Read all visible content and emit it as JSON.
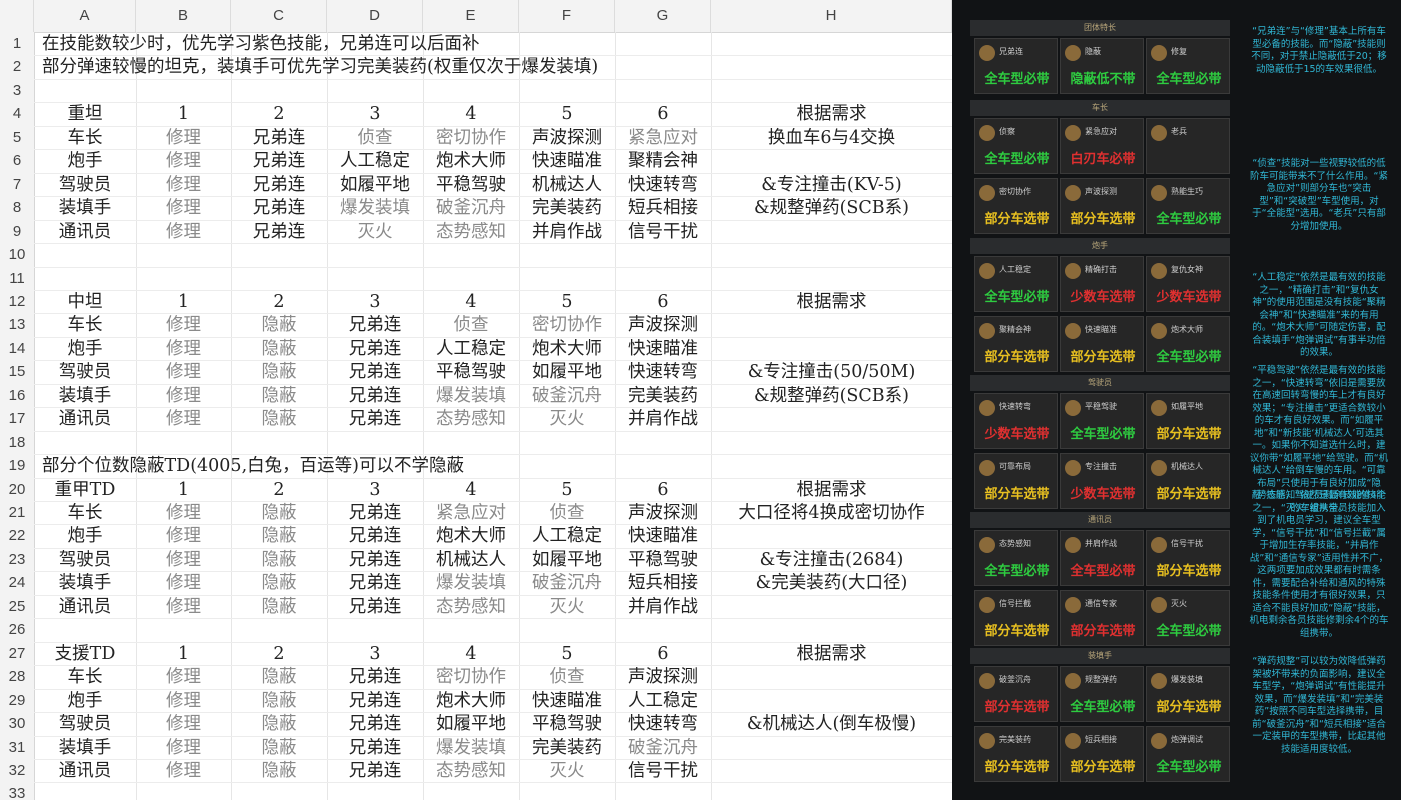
{
  "columns": [
    "A",
    "B",
    "C",
    "D",
    "E",
    "F",
    "G",
    "H"
  ],
  "rows": [
    "1",
    "2",
    "3",
    "4",
    "5",
    "6",
    "7",
    "8",
    "9",
    "10",
    "11",
    "12",
    "13",
    "14",
    "15",
    "16",
    "17",
    "18",
    "19",
    "20",
    "21",
    "22",
    "23",
    "24",
    "25",
    "26",
    "27",
    "28",
    "29",
    "30",
    "31",
    "32",
    "33"
  ],
  "notes": {
    "r1": "在技能数较少时，优先学习紫色技能，兄弟连可以后面补",
    "r2": "部分弹速较慢的坦克，装填手可优先学习完美装药(权重仅次于爆发装填)",
    "r19": "部分个位数隐蔽TD(4005,白兔，百运等)可以不学隐蔽"
  },
  "tables": [
    {
      "title": "重坦",
      "nums": [
        "1",
        "2",
        "3",
        "4",
        "5",
        "6"
      ],
      "need": "根据需求",
      "rows": [
        {
          "role": "车长",
          "skills": [
            "修理",
            "兄弟连",
            "侦查",
            "密切协作",
            "声波探测",
            "紧急应对"
          ],
          "note": "换血车6与4交换"
        },
        {
          "role": "炮手",
          "skills": [
            "修理",
            "兄弟连",
            "人工稳定",
            "炮术大师",
            "快速瞄准",
            "聚精会神"
          ],
          "note": ""
        },
        {
          "role": "驾驶员",
          "skills": [
            "修理",
            "兄弟连",
            "如履平地",
            "平稳驾驶",
            "机械达人",
            "快速转弯"
          ],
          "note": "&专注撞击(KV-5)"
        },
        {
          "role": "装填手",
          "skills": [
            "修理",
            "兄弟连",
            "爆发装填",
            "破釜沉舟",
            "完美装药",
            "短兵相接"
          ],
          "note": "&规整弹药(SCB系)"
        },
        {
          "role": "通讯员",
          "skills": [
            "修理",
            "兄弟连",
            "灭火",
            "态势感知",
            "并肩作战",
            "信号干扰"
          ],
          "note": ""
        }
      ]
    },
    {
      "title": "中坦",
      "nums": [
        "1",
        "2",
        "3",
        "4",
        "5",
        "6"
      ],
      "need": "根据需求",
      "rows": [
        {
          "role": "车长",
          "skills": [
            "修理",
            "隐蔽",
            "兄弟连",
            "侦查",
            "密切协作",
            "声波探测"
          ],
          "note": ""
        },
        {
          "role": "炮手",
          "skills": [
            "修理",
            "隐蔽",
            "兄弟连",
            "人工稳定",
            "炮术大师",
            "快速瞄准"
          ],
          "note": ""
        },
        {
          "role": "驾驶员",
          "skills": [
            "修理",
            "隐蔽",
            "兄弟连",
            "平稳驾驶",
            "如履平地",
            "快速转弯"
          ],
          "note": "&专注撞击(50/50M)"
        },
        {
          "role": "装填手",
          "skills": [
            "修理",
            "隐蔽",
            "兄弟连",
            "爆发装填",
            "破釜沉舟",
            "完美装药"
          ],
          "note": "&规整弹药(SCB系)"
        },
        {
          "role": "通讯员",
          "skills": [
            "修理",
            "隐蔽",
            "兄弟连",
            "态势感知",
            "灭火",
            "并肩作战"
          ],
          "note": ""
        }
      ]
    },
    {
      "title": "重甲TD",
      "nums": [
        "1",
        "2",
        "3",
        "4",
        "5",
        "6"
      ],
      "need": "根据需求",
      "rows": [
        {
          "role": "车长",
          "skills": [
            "修理",
            "隐蔽",
            "兄弟连",
            "紧急应对",
            "侦查",
            "声波探测"
          ],
          "note": "大口径将4换成密切协作"
        },
        {
          "role": "炮手",
          "skills": [
            "修理",
            "隐蔽",
            "兄弟连",
            "炮术大师",
            "人工稳定",
            "快速瞄准"
          ],
          "note": ""
        },
        {
          "role": "驾驶员",
          "skills": [
            "修理",
            "隐蔽",
            "兄弟连",
            "机械达人",
            "如履平地",
            "平稳驾驶"
          ],
          "note": "&专注撞击(2684)"
        },
        {
          "role": "装填手",
          "skills": [
            "修理",
            "隐蔽",
            "兄弟连",
            "爆发装填",
            "破釜沉舟",
            "短兵相接"
          ],
          "note": "&完美装药(大口径)"
        },
        {
          "role": "通讯员",
          "skills": [
            "修理",
            "隐蔽",
            "兄弟连",
            "态势感知",
            "灭火",
            "并肩作战"
          ],
          "note": ""
        }
      ]
    },
    {
      "title": "支援TD",
      "nums": [
        "1",
        "2",
        "3",
        "4",
        "5",
        "6"
      ],
      "need": "根据需求",
      "rows": [
        {
          "role": "车长",
          "skills": [
            "修理",
            "隐蔽",
            "兄弟连",
            "密切协作",
            "侦查",
            "声波探测"
          ],
          "note": ""
        },
        {
          "role": "炮手",
          "skills": [
            "修理",
            "隐蔽",
            "兄弟连",
            "炮术大师",
            "快速瞄准",
            "人工稳定"
          ],
          "note": ""
        },
        {
          "role": "驾驶员",
          "skills": [
            "修理",
            "隐蔽",
            "兄弟连",
            "如履平地",
            "平稳驾驶",
            "快速转弯"
          ],
          "note": "&机械达人(倒车极慢)"
        },
        {
          "role": "装填手",
          "skills": [
            "修理",
            "隐蔽",
            "兄弟连",
            "爆发装填",
            "完美装药",
            "破釜沉舟"
          ],
          "note": ""
        },
        {
          "role": "通讯员",
          "skills": [
            "修理",
            "隐蔽",
            "兄弟连",
            "态势感知",
            "灭火",
            "信号干扰"
          ],
          "note": ""
        }
      ]
    }
  ],
  "panel": {
    "sections": [
      {
        "head": "团体特长",
        "cards": [
          {
            "name": "兄弟连",
            "tag": "全车型必带",
            "color": "#2ecc40"
          },
          {
            "name": "隐蔽",
            "tag": "隐蔽低不带",
            "color": "#2ecc40"
          },
          {
            "name": "修复",
            "tag": "全车型必带",
            "color": "#2ecc40"
          }
        ]
      },
      {
        "head": "车长",
        "cards": [
          {
            "name": "侦察",
            "tag": "全车型必带",
            "color": "#2ecc40"
          },
          {
            "name": "紧急应对",
            "tag": "白刃车必带",
            "color": "#e03030"
          },
          {
            "name": "老兵",
            "tag": "",
            "color": "#3050e0"
          },
          {
            "name": "密切协作",
            "tag": "部分车选带",
            "color": "#e8c020"
          },
          {
            "name": "声波探测",
            "tag": "部分车选带",
            "color": "#e8c020"
          },
          {
            "name": "熟能生巧",
            "tag": "全车型必带",
            "color": "#2ecc40"
          }
        ]
      },
      {
        "head": "炮手",
        "cards": [
          {
            "name": "人工稳定",
            "tag": "全车型必带",
            "color": "#2ecc40"
          },
          {
            "name": "精确打击",
            "tag": "少数车选带",
            "color": "#e03030"
          },
          {
            "name": "复仇女神",
            "tag": "少数车选带",
            "color": "#e03030"
          },
          {
            "name": "聚精会神",
            "tag": "部分车选带",
            "color": "#e8c020"
          },
          {
            "name": "快速瞄准",
            "tag": "部分车选带",
            "color": "#e8c020"
          },
          {
            "name": "炮术大师",
            "tag": "全车型必带",
            "color": "#2ecc40"
          }
        ]
      },
      {
        "head": "驾驶员",
        "cards": [
          {
            "name": "快速转弯",
            "tag": "少数车选带",
            "color": "#e03030"
          },
          {
            "name": "平稳驾驶",
            "tag": "全车型必带",
            "color": "#2ecc40"
          },
          {
            "name": "如履平地",
            "tag": "部分车选带",
            "color": "#e8c020"
          },
          {
            "name": "可靠布局",
            "tag": "部分车选带",
            "color": "#e8c020"
          },
          {
            "name": "专注撞击",
            "tag": "少数车选带",
            "color": "#e03030"
          },
          {
            "name": "机械达人",
            "tag": "部分车选带",
            "color": "#e8c020"
          }
        ]
      },
      {
        "head": "通讯员",
        "cards": [
          {
            "name": "态势感知",
            "tag": "全车型必带",
            "color": "#2ecc40"
          },
          {
            "name": "并肩作战",
            "tag": "全车型必带",
            "color": "#e03030"
          },
          {
            "name": "信号干扰",
            "tag": "部分车选带",
            "color": "#e8c020"
          },
          {
            "name": "信号拦截",
            "tag": "部分车选带",
            "color": "#e8c020"
          },
          {
            "name": "通信专家",
            "tag": "部分车选带",
            "color": "#e03030"
          },
          {
            "name": "灭火",
            "tag": "全车型必带",
            "color": "#2ecc40"
          }
        ]
      },
      {
        "head": "装填手",
        "cards": [
          {
            "name": "破釜沉舟",
            "tag": "部分车选带",
            "color": "#e03030"
          },
          {
            "name": "规整弹药",
            "tag": "全车型必带",
            "color": "#2ecc40"
          },
          {
            "name": "爆发装填",
            "tag": "部分车选带",
            "color": "#e8c020"
          },
          {
            "name": "完美装药",
            "tag": "部分车选带",
            "color": "#e8c020"
          },
          {
            "name": "短兵相接",
            "tag": "部分车选带",
            "color": "#e8c020"
          },
          {
            "name": "炮弹调试",
            "tag": "全车型必带",
            "color": "#2ecc40"
          }
        ]
      }
    ],
    "notes": [
      "“兄弟连”与“修理”基本上所有车型必备的技能。而“隐蔽”技能则不同，对于禁止隐蔽低于20；移动隐蔽低于15的车效果很低。",
      "“侦查”技能对一些视野较低的低阶车可能带来不了什么作用。“紧急应对”则部分车也“突击型”和“突破型”车型使用，对于“全能型”选用。“老兵”只有部分增加使用。",
      "“人工稳定”依然是最有效的技能之一，“精确打击”和“复仇女神”的使用范围是没有技能“聚精会神”和“快速瞄准”来的有用的。“炮术大师”可随定伤害，配合装填手“炮弹调试”有事半功倍的效果。",
      "“平稳驾驶”依然是最有效的技能之一，“快速转弯”依旧是需要放在高速回转弯慢的车上才有良好效果；“专注撞击”更适合数较小的车才有良好效果。而“如履平地”和“新技能‘机械达人’可选其一。如果你不知道选什么时，建议你带“如履平地”给驾驶。而“机械达人”给倒车慢的车用。“可靠布局”只使用于有良好加成“隐蔽”技能，驾驶员剩余技能修4个的车组携带。",
      "“势态感知”依然是最有效的技能之一，“灭火”被从全员技能加入到了机电员学习，建议全车型学，“信号干扰”和“信号拦截”属于增加生存率技能，“并肩作战”和“通信专家”适用性并不广，这两项要加成效果都有时需条件，需要配合补给和通风的特殊技能条件使用才有很好效果，只适合不能良好加成“隐蔽”技能，机电剩余各员技能修剩余4个的车组携带。",
      "“弹药规整”可以较为效降低弹药架被坏带来的负面影响，建议全车型学，“炮弹调试”有性能提升效果，而“爆发装填”和“完美装药”按照不同车型选择携带，目前“破釜沉舟”和“短兵相接”适合一定装甲的车型携带，比起其他技能适用度较低。"
    ]
  }
}
